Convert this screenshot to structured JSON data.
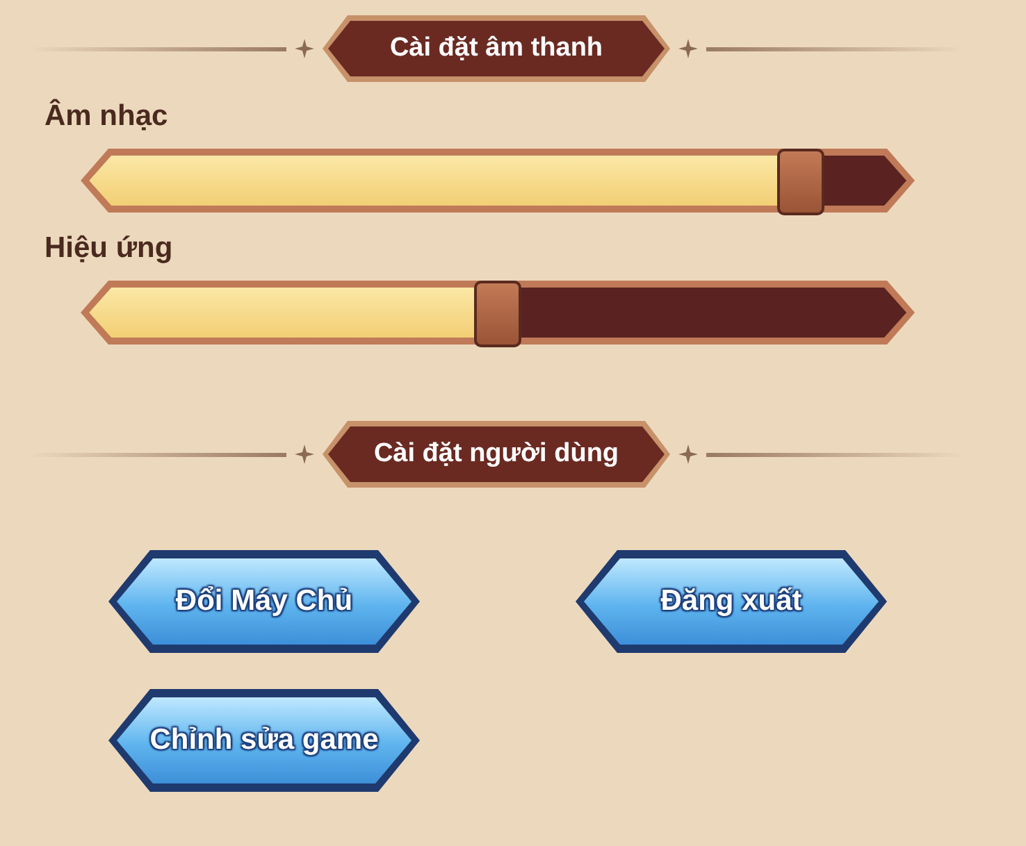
{
  "sections": [
    {
      "title": "Cài đặt âm thanh",
      "sliders": [
        {
          "label": "Âm nhạc",
          "level": 0.87
        },
        {
          "label": "Hiệu ứng",
          "level": 0.5
        }
      ]
    },
    {
      "title": "Cài đặt người dùng",
      "buttons": [
        "Đổi Máy Chủ",
        "Đăng xuất",
        "Chỉnh sửa game"
      ]
    }
  ]
}
